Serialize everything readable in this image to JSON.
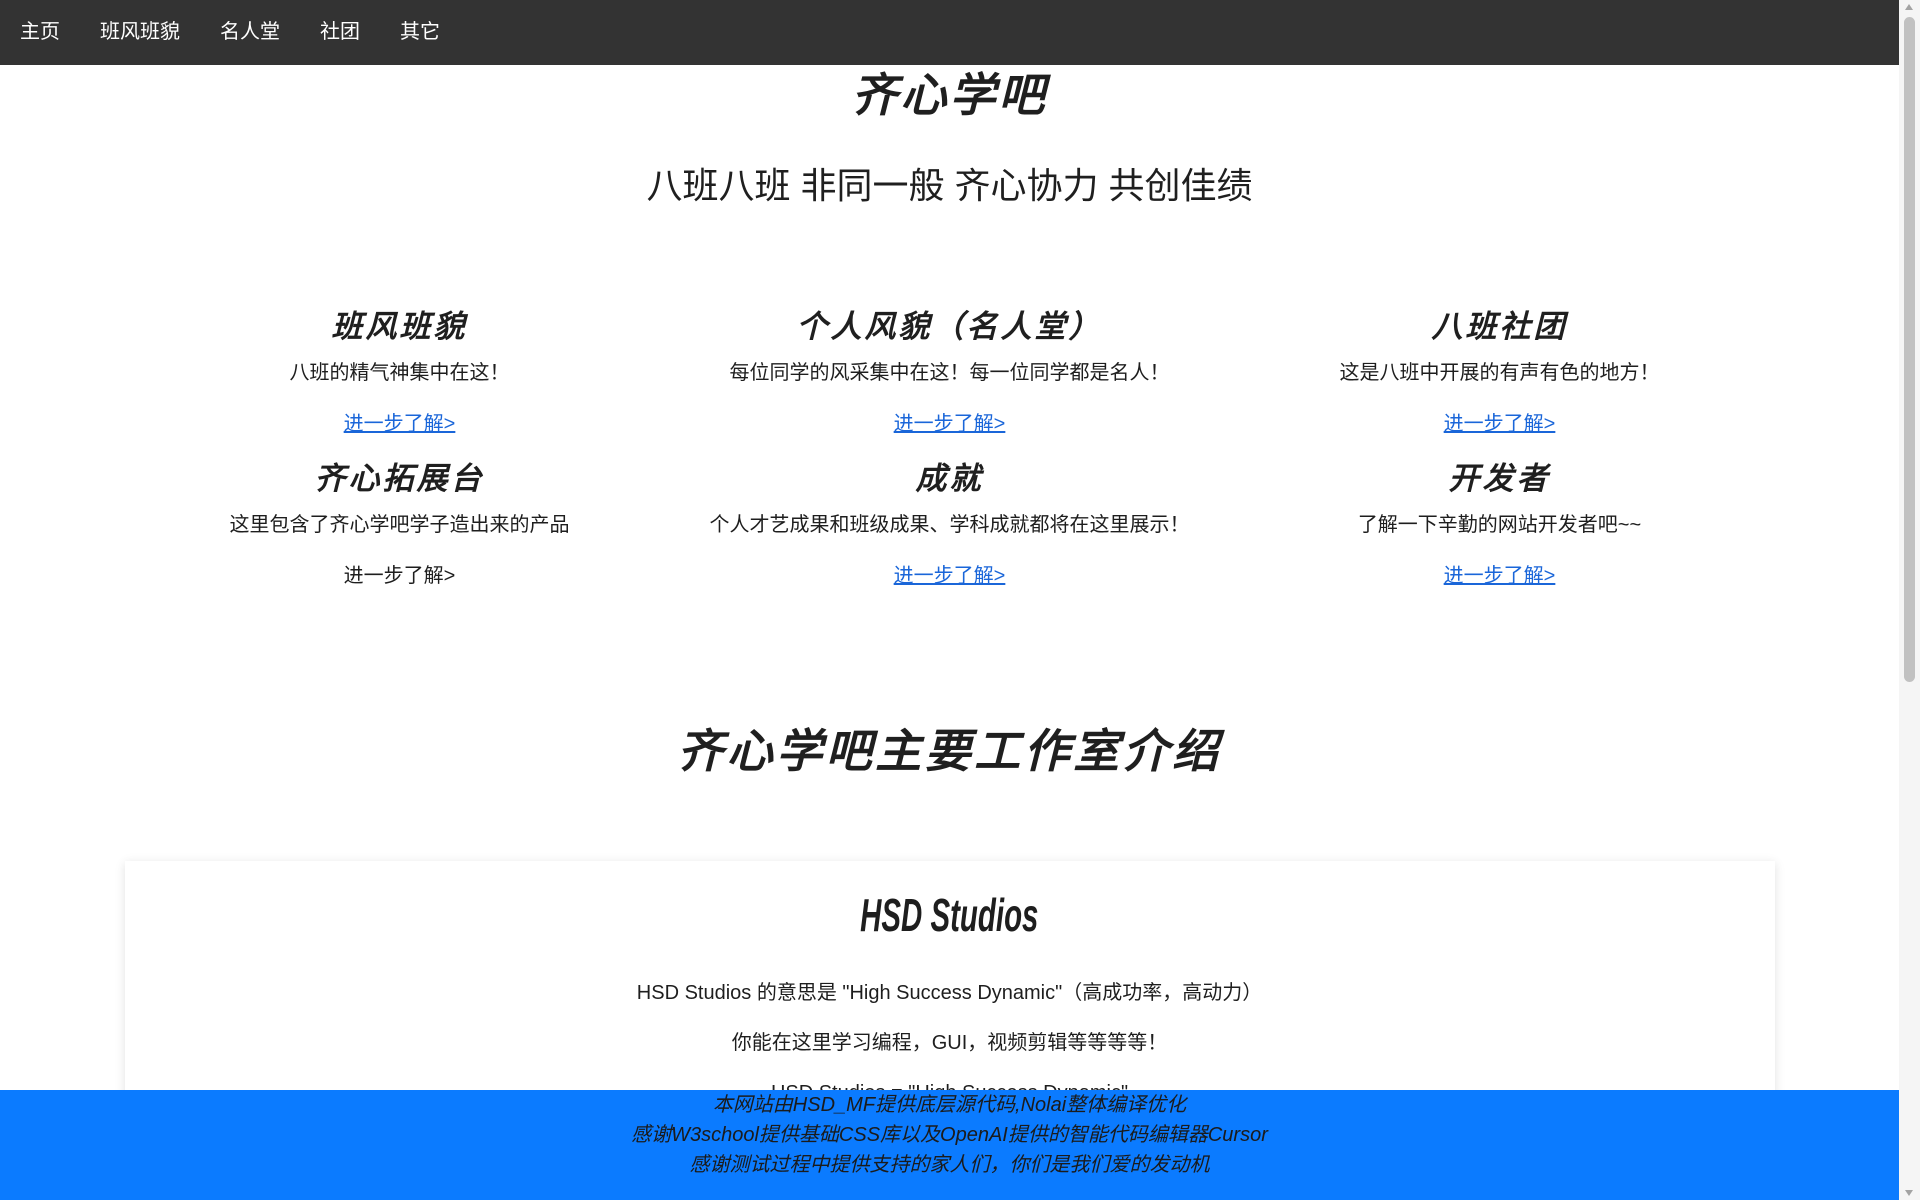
{
  "colors": {
    "nav_bg": "#333333",
    "nav_text": "#ffffff",
    "text": "#1e1e1e",
    "link": "#1a66d9",
    "footer_bg": "#0b7bff",
    "footer_text": "#1b1b1b",
    "scroll_thumb": "#c1c1c1"
  },
  "nav": {
    "items": [
      {
        "label": "主页"
      },
      {
        "label": "班风班貌"
      },
      {
        "label": "名人堂"
      },
      {
        "label": "社团"
      },
      {
        "label": "其它"
      }
    ]
  },
  "hero": {
    "title": "齐心学吧",
    "subtitle": "八班八班 非同一般 齐心协力 共创佳绩"
  },
  "features": [
    {
      "title": "班风班貌",
      "description": "八班的精气神集中在这！",
      "link": "进一步了解>"
    },
    {
      "title": "个人风貌（名人堂）",
      "description": "每位同学的风采集中在这！每一位同学都是名人！",
      "link": "进一步了解>"
    },
    {
      "title": "八班社团",
      "description": "这是八班中开展的有声有色的地方！",
      "link": "进一步了解>"
    },
    {
      "title": "齐心拓展台",
      "description": "这里包含了齐心学吧学子造出来的产品",
      "link": "进一步了解>"
    },
    {
      "title": "成就",
      "description": "个人才艺成果和班级成果、学科成就都将在这里展示！",
      "link": "进一步了解>"
    },
    {
      "title": "开发者",
      "description": "了解一下辛勤的网站开发者吧~~",
      "link": "进一步了解>"
    }
  ],
  "studios": {
    "heading": "齐心学吧主要工作室介绍",
    "card": {
      "title": "HSD Studios",
      "paragraphs": [
        "HSD Studios 的意思是 \"High Success Dynamic\"（高成功率，高动力）",
        "你能在这里学习编程，GUI，视频剪辑等等等等！",
        "HSD Studios = \"High Success Dynamic\""
      ]
    }
  },
  "footer": {
    "lines": [
      "本网站由HSD_MF提供底层源代码,Nolai整体编译优化",
      "感谢W3school提供基础CSS库以及OpenAI提供的智能代码编辑器Cursor",
      "感谢测试过程中提供支持的家人们，你们是我们爱的发动机"
    ]
  },
  "scrollbar": {
    "scroll_fraction": 0,
    "visible_fraction": 0.57
  }
}
